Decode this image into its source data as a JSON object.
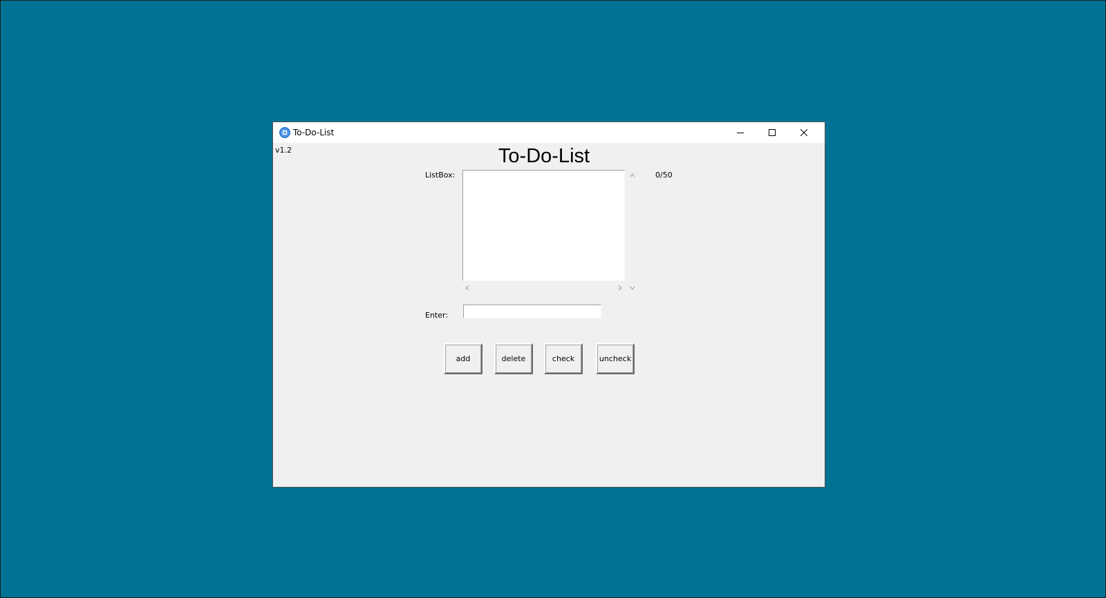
{
  "window": {
    "title": "To-Do-List",
    "icon": "app-icon",
    "controls": [
      "minimize-icon",
      "maximize-icon",
      "close-icon"
    ]
  },
  "app": {
    "version": "v1.2",
    "heading": "To-Do-List",
    "listbox_label": "ListBox:",
    "counter": "0/50",
    "listbox_items": [],
    "enter_label": "Enter:",
    "entry_value": ""
  },
  "buttons": {
    "add": "add",
    "delete": "delete",
    "check": "check",
    "uncheck": "uncheck"
  },
  "colors": {
    "desktop": "#007394",
    "window_bg": "#f0f0f0",
    "titlebar": "#ffffff"
  }
}
